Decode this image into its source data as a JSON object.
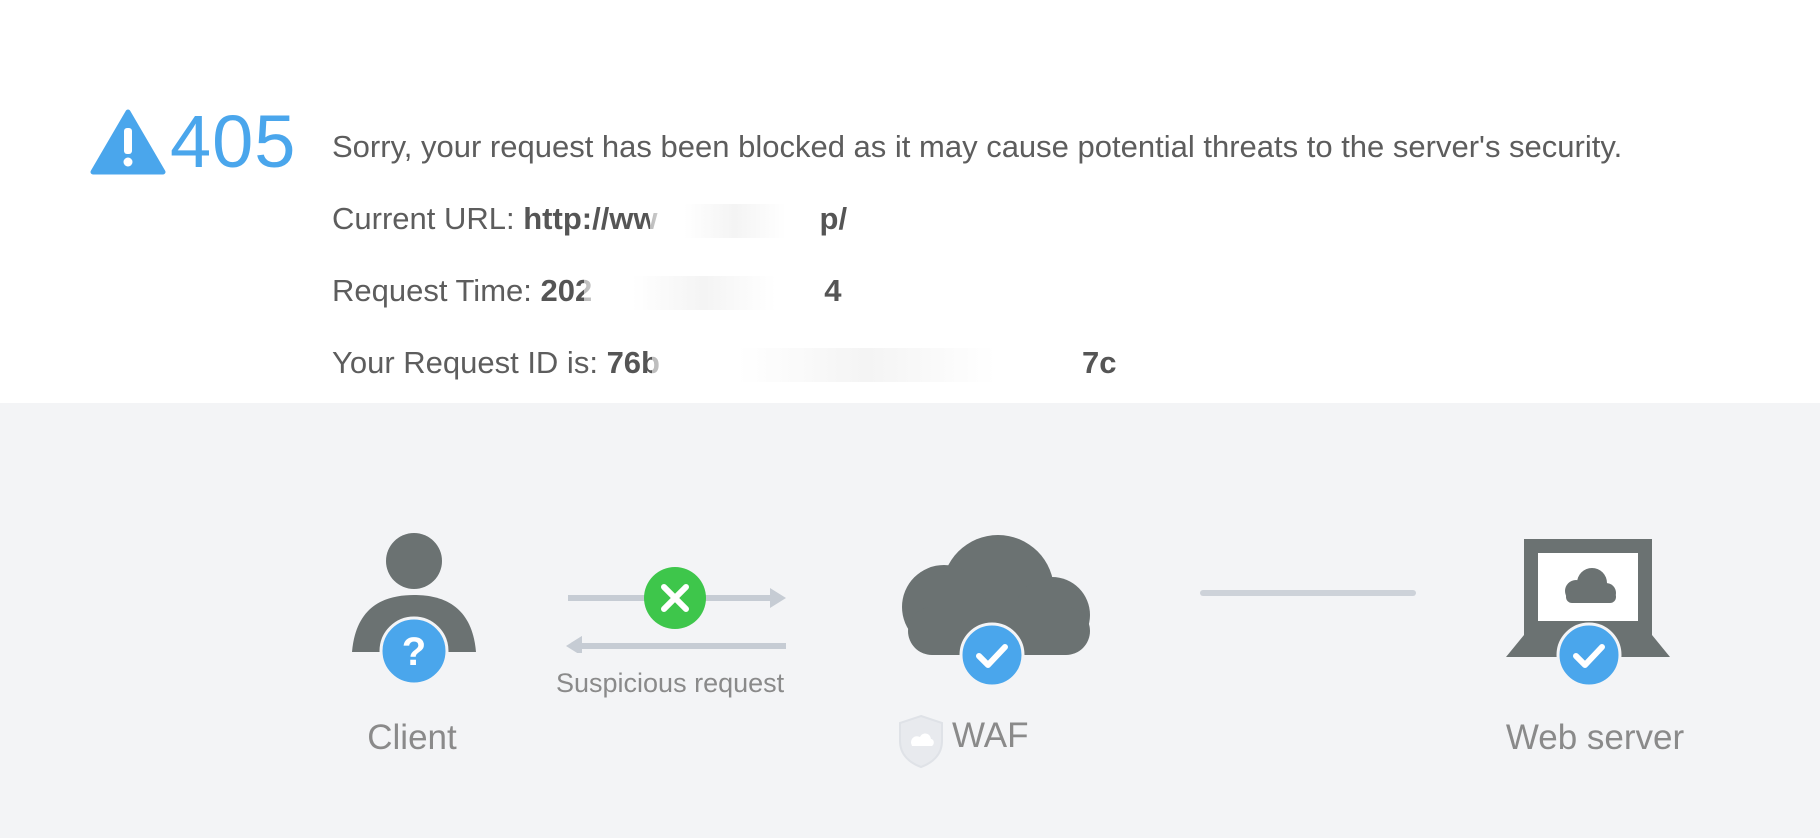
{
  "error": {
    "code": "405",
    "message": "Sorry, your request has been blocked as it may cause potential threats to the server's security."
  },
  "details": {
    "url_label": "Current URL: ",
    "url_value_start": "http://ww",
    "url_value_end": "p/",
    "time_label": "Request Time: ",
    "time_value_start": "202",
    "time_value_end": "4",
    "id_label": "Your Request ID is: ",
    "id_value_start": "76b",
    "id_value_end": "7c"
  },
  "diagram": {
    "client_label": "Client",
    "request_label": "Suspicious request",
    "waf_label": "WAF",
    "server_label": "Web server"
  },
  "icons": {
    "warning": "warning-triangle-icon",
    "client": "user-icon",
    "question": "question-mark-icon",
    "blocked": "x-circle-icon",
    "cloud": "cloud-icon",
    "check": "check-circle-icon",
    "shield": "shield-icon",
    "laptop": "laptop-icon"
  },
  "colors": {
    "accent_blue": "#4aa6ec",
    "blocked_green": "#3ec64b",
    "icon_gray": "#6b7272",
    "text_gray": "#5d5d5d",
    "background_gray": "#f3f4f6"
  }
}
